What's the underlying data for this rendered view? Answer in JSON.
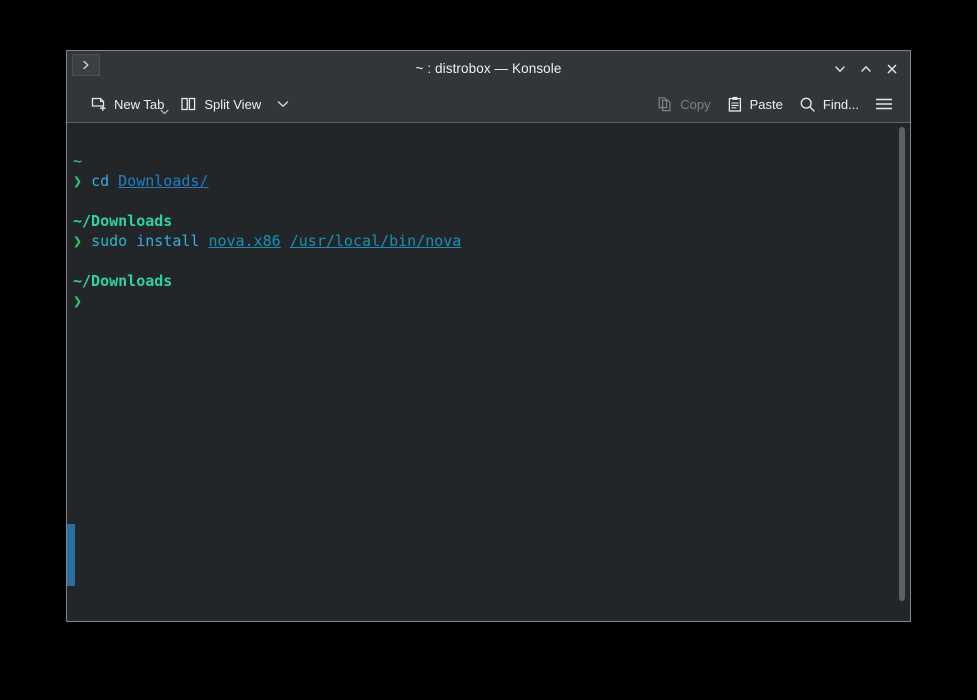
{
  "window": {
    "title": "~ : distrobox — Konsole",
    "tab_icon": "chevron-right-icon",
    "controls": {
      "minimize": "minimize-icon",
      "maximize": "maximize-icon",
      "close": "close-icon"
    },
    "colors": {
      "chrome": "#31363b",
      "terminal_bg": "#232629",
      "border": "#7f8689",
      "accent_green": "#2fd39b",
      "accent_blue_link": "#1f7fc0",
      "selection": "#2a6fa3",
      "text": "#eff0f1",
      "text_disabled": "#7d8387"
    }
  },
  "toolbar": {
    "new_tab_label": "New Tab",
    "new_tab_icon": "new-tab-icon",
    "new_tab_caret_icon": "chevron-down-icon",
    "split_view_label": "Split View",
    "split_view_icon": "split-view-icon",
    "split_view_caret_icon": "chevron-down-icon",
    "copy_label": "Copy",
    "copy_icon": "copy-icon",
    "copy_enabled": false,
    "paste_label": "Paste",
    "paste_icon": "paste-icon",
    "find_label": "Find...",
    "find_icon": "search-icon",
    "menu_icon": "hamburger-menu-icon"
  },
  "terminal": {
    "lines": [
      {
        "type": "blank",
        "segments": []
      },
      {
        "type": "path",
        "segments": [
          {
            "text": "~",
            "style": "c-green"
          }
        ]
      },
      {
        "type": "command",
        "segments": [
          {
            "text": "❯",
            "style": "c-prompt"
          },
          {
            "text": " ",
            "style": "plain"
          },
          {
            "text": "cd",
            "style": "c-cmd"
          },
          {
            "text": " ",
            "style": "plain"
          },
          {
            "text": "Downloads/",
            "style": "c-link"
          }
        ]
      },
      {
        "type": "blank",
        "segments": []
      },
      {
        "type": "path",
        "segments": [
          {
            "text": "~/Downloads",
            "style": "c-green-b"
          }
        ]
      },
      {
        "type": "command",
        "segments": [
          {
            "text": "❯",
            "style": "c-prompt"
          },
          {
            "text": " ",
            "style": "plain"
          },
          {
            "text": "sudo",
            "style": "c-cyan"
          },
          {
            "text": " ",
            "style": "plain"
          },
          {
            "text": "install",
            "style": "c-cmd"
          },
          {
            "text": " ",
            "style": "plain"
          },
          {
            "text": "nova.x86",
            "style": "c-link2"
          },
          {
            "text": " ",
            "style": "plain"
          },
          {
            "text": "/usr/local/bin/nova",
            "style": "c-link2"
          }
        ]
      },
      {
        "type": "blank",
        "segments": []
      },
      {
        "type": "path",
        "segments": [
          {
            "text": "~/Downloads",
            "style": "c-green-b"
          }
        ]
      },
      {
        "type": "command",
        "segments": [
          {
            "text": "❯",
            "style": "c-prompt"
          }
        ]
      }
    ]
  },
  "scrollbar": {
    "orientation": "vertical"
  }
}
